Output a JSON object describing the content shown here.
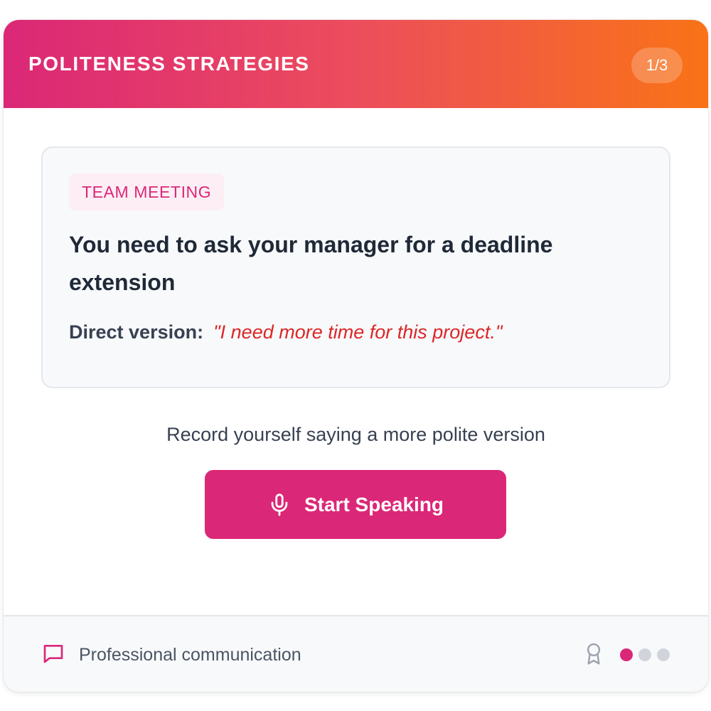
{
  "header": {
    "title": "POLITENESS STRATEGIES",
    "progress": "1/3"
  },
  "scenario": {
    "tag": "TEAM MEETING",
    "prompt": "You need to ask your manager for a deadline extension",
    "direct_label": "Direct version:",
    "direct_quote": "\"I need more time for this project.\""
  },
  "instruction": "Record yourself saying a more polite version",
  "speak_button": {
    "label": "Start Speaking",
    "icon": "microphone-icon"
  },
  "footer": {
    "category_icon": "chat-bubble-icon",
    "category_label": "Professional communication",
    "award_icon": "award-icon",
    "progress_dots": {
      "total": 3,
      "current": 1
    }
  },
  "colors": {
    "accent": "#db2777",
    "gradient_start": "#db2777",
    "gradient_end": "#f97316",
    "direct_quote": "#dc2626"
  }
}
